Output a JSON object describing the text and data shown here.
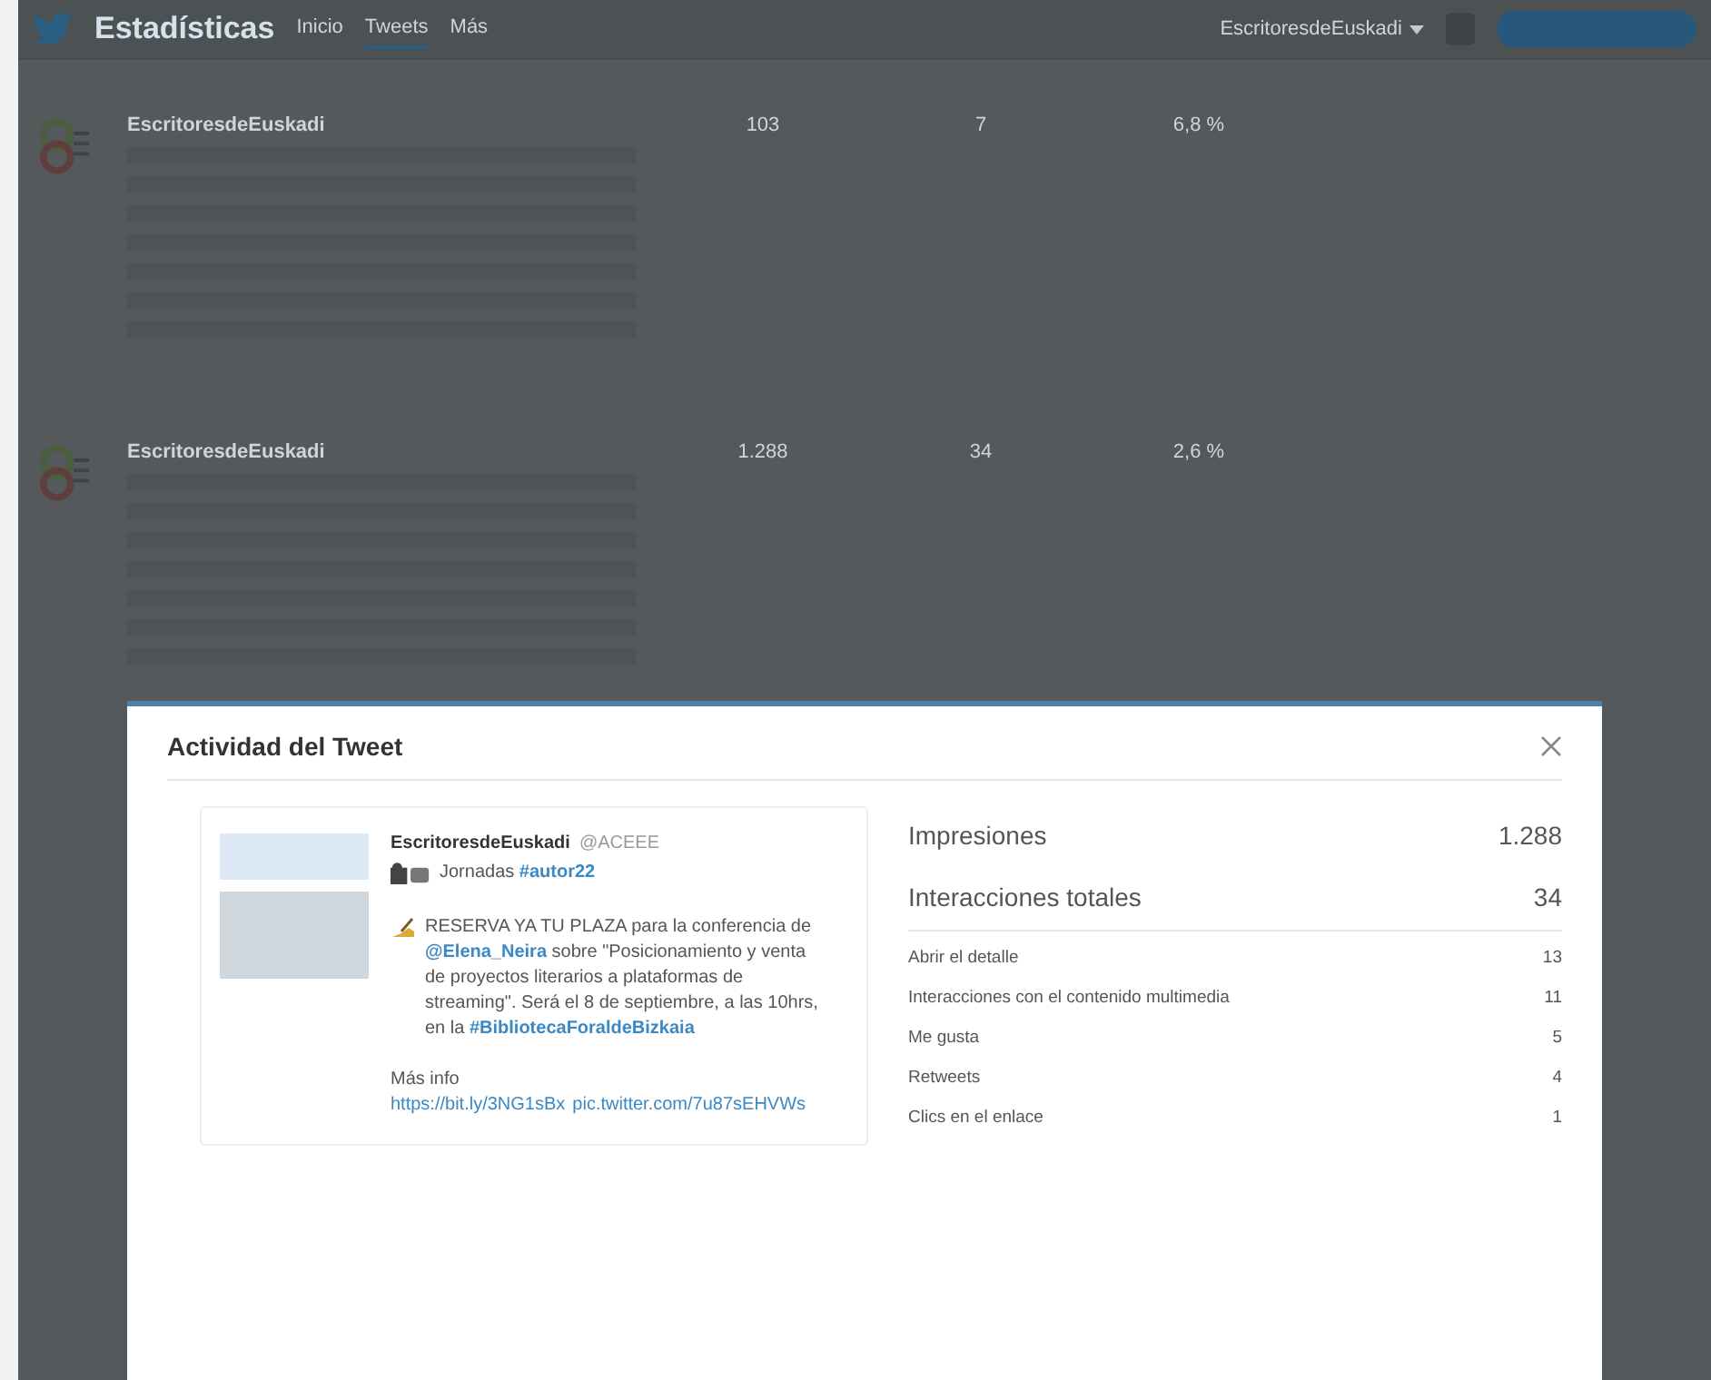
{
  "header": {
    "title": "Estadísticas",
    "nav": [
      {
        "label": "Inicio",
        "selected": false
      },
      {
        "label": "Tweets",
        "selected": true
      },
      {
        "label": "Más",
        "selected": false
      }
    ],
    "account": "EscritoresdeEuskadi"
  },
  "background_tweets": [
    {
      "author": "EscritoresdeEuskadi",
      "stats": [
        "103",
        "7",
        "6,8 %"
      ]
    },
    {
      "author": "EscritoresdeEuskadi",
      "stats": [
        "1.288",
        "34",
        "2,6 %"
      ]
    }
  ],
  "modal": {
    "title": "Actividad del Tweet",
    "tweet": {
      "author": "EscritoresdeEuskadi",
      "handle": "@ACEEE",
      "subtitle": [
        {
          "kind": "text",
          "text": "Jornadas "
        },
        {
          "kind": "link",
          "text": "#autor22"
        }
      ],
      "body": [
        {
          "kind": "text",
          "text": "RESERVA YA TU PLAZA para la conferencia de "
        },
        {
          "kind": "link",
          "text": "@Elena_Neira"
        },
        {
          "kind": "text",
          "text": " sobre \"Posicionamiento y venta de proyectos literarios a plataformas de streaming\". Será el 8 de septiembre, a las 10hrs, en la "
        },
        {
          "kind": "link",
          "text": "#BibliotecaForaldeBizkaia"
        }
      ],
      "footer": [
        {
          "kind": "text",
          "text": "Más info "
        },
        {
          "kind": "link",
          "text": "https://bit.ly/3NG1sBx"
        },
        {
          "kind": "link",
          "text": "pic.twitter.com/7u87sEHVWs"
        }
      ]
    },
    "totals": [
      {
        "label": "Impresiones",
        "value": "1.288"
      },
      {
        "label": "Interacciones totales",
        "value": "34"
      }
    ],
    "breakdown": [
      {
        "label": "Abrir el detalle",
        "value": "13"
      },
      {
        "label": "Interacciones con el contenido multimedia",
        "value": "11"
      },
      {
        "label": "Me gusta",
        "value": "5"
      },
      {
        "label": "Retweets",
        "value": "4"
      },
      {
        "label": "Clics en el enlace",
        "value": "1"
      }
    ]
  }
}
